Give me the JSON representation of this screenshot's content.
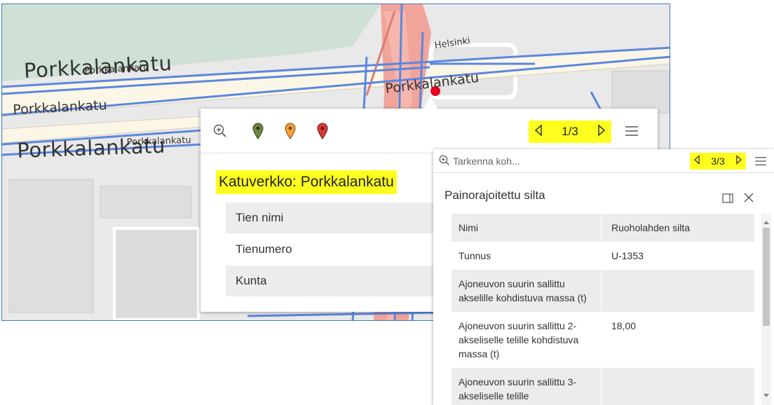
{
  "map": {
    "labels": {
      "porkkalankatu_big_left": "Porkkalankatu",
      "porkkalankatu_overlap_small": "Porkkalankatu",
      "porkkalankatu_mid_left": "Porkkalankatu",
      "porkkalankatu_big_lower": "Porkkalankatu",
      "porkkalankatu_overlap_lower": "Porkkalankatu",
      "porkkalankatu_right": "Porkkalankatu",
      "helsinki": "Helsinki"
    },
    "colors": {
      "background": "#e9e9e9",
      "park": "#cfe0d5",
      "road_pink": "#f0a49a",
      "road_blue": "#5b87e0",
      "road_light": "#fbf6e6",
      "marker": "#e8001c"
    }
  },
  "popup1": {
    "toolbar": {
      "zoom_icon": "zoom-in-icon",
      "pins": [
        {
          "icon": "map-pin-green-icon",
          "color": "#6b8a3c"
        },
        {
          "icon": "map-pin-orange-icon",
          "color": "#f3a03a"
        },
        {
          "icon": "map-pin-red-icon",
          "color": "#d93a3a"
        }
      ],
      "nav_count": "1/3",
      "highlight_color": "#ffff1f",
      "menu_icon": "hamburger-menu-icon"
    },
    "title": "Katuverkko: Porkkalankatu",
    "rows": [
      {
        "label": "Tien nimi"
      },
      {
        "label": "Tienumero"
      },
      {
        "label": "Kunta"
      }
    ]
  },
  "popup2": {
    "search": {
      "placeholder": "Tarkenna koh...",
      "icon": "zoom-search-icon"
    },
    "nav_count": "3/3",
    "menu_icon": "hamburger-menu-icon",
    "title": "Painorajoitettu silta",
    "panel_icon": "dock-panel-icon",
    "close_icon": "close-icon",
    "table": [
      {
        "label": "Nimi",
        "value": "Ruoholahden silta"
      },
      {
        "label": "Tunnus",
        "value": "U-1353"
      },
      {
        "label": "Ajoneuvon suurin sallittu akselille kohdistuva massa (t)",
        "value": ""
      },
      {
        "label": "Ajoneuvon suurin sallittu 2-akseliselle telille kohdistuva massa (t)",
        "value": "18,00"
      },
      {
        "label": "Ajoneuvon suurin sallittu 3-akseliselle telille",
        "value": ""
      }
    ]
  }
}
